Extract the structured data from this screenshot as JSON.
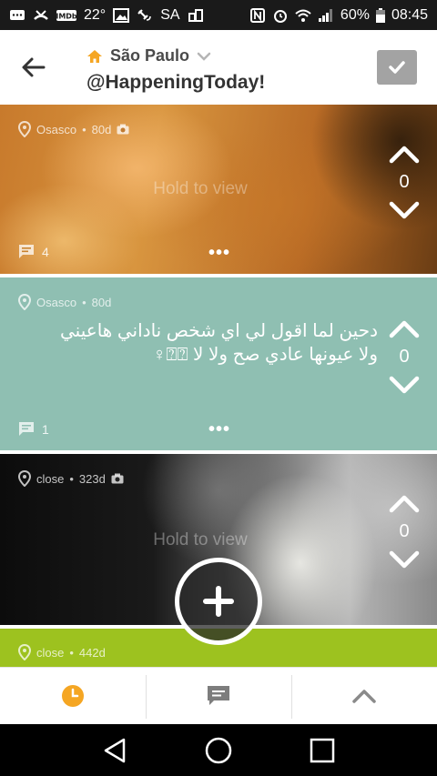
{
  "status_bar": {
    "temperature": "22°",
    "carrier": "SA",
    "battery": "60%",
    "time": "08:45"
  },
  "header": {
    "location": "São Paulo",
    "handle": "@HappeningToday!"
  },
  "feed": [
    {
      "location": "Osasco",
      "age": "80d",
      "has_photo": true,
      "hold_text": "Hold to view",
      "votes": "0",
      "comments": "4",
      "more": "•••"
    },
    {
      "location": "Osasco",
      "age": "80d",
      "has_photo": false,
      "text": "دحين لما اقول لي اي شخص ناداني هاعيني ولا عيونها عادي صح ولا لا ⍰⍰♀",
      "votes": "0",
      "comments": "1",
      "more": "•••"
    },
    {
      "location": "close",
      "age": "323d",
      "has_photo": true,
      "hold_text": "Hold to view",
      "votes": "0"
    },
    {
      "location": "close",
      "age": "442d"
    }
  ],
  "colors": {
    "accent": "#f5a623",
    "card_teal": "#8fbfb2",
    "card_green": "#9dc21f",
    "check_button": "#a3a3a3"
  },
  "tabs": [
    {
      "name": "recent",
      "icon": "clock-icon",
      "active": true
    },
    {
      "name": "comments",
      "icon": "chat-icon",
      "active": false
    },
    {
      "name": "top",
      "icon": "chevron-up-icon",
      "active": false
    }
  ]
}
